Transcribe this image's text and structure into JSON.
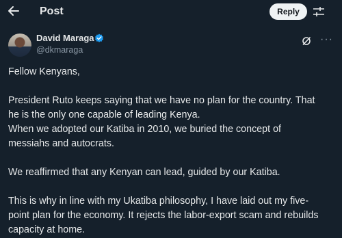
{
  "header": {
    "title": "Post",
    "reply_label": "Reply",
    "back_icon": "arrow-left-icon",
    "settings_icon": "sliders-icon"
  },
  "author": {
    "name": "David Maraga",
    "handle": "@dkmaraga",
    "verified_icon": "verified-badge-icon",
    "verified_color": "#1d9bf0"
  },
  "actions": {
    "grok_icon": "grok-icon",
    "more_label": "···"
  },
  "post": {
    "greeting": "Fellow Kenyans,",
    "para1_line1": "President Ruto keeps saying that we have no plan for the country. That",
    "para1_line2": "he is the only one capable of leading Kenya.",
    "para1_line3": "When we adopted our Katiba in 2010, we buried the concept of",
    "para1_line4": "messiahs and autocrats.",
    "para2": "We reaffirmed that any Kenyan can lead, guided by our Katiba.",
    "para3_line1": "This is why in line with my Ukatiba philosophy, I have laid out my five-",
    "para3_line2": "point plan for the economy. It rejects the labor-export scam and rebuilds",
    "para3_line3": "capacity at home."
  },
  "theme": {
    "background": "#15202b",
    "text": "#e7e9ea",
    "muted": "#8b98a5"
  }
}
